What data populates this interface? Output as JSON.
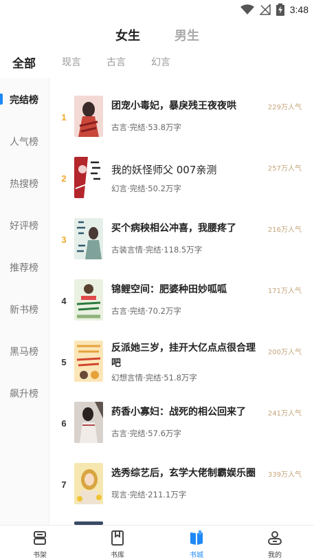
{
  "status_bar": {
    "time": "3:48"
  },
  "gender_tabs": {
    "female": "女生",
    "male": "男生"
  },
  "category_tabs": [
    "全部",
    "现言",
    "古言",
    "幻言"
  ],
  "sidebar": {
    "items": [
      "完结榜",
      "人气榜",
      "热搜榜",
      "好评榜",
      "推荐榜",
      "新书榜",
      "黑马榜",
      "飙升榜"
    ],
    "active_index": 0
  },
  "books": [
    {
      "rank": "1",
      "title": "团宠小毒妃，暴戾残王夜夜哄",
      "meta": "古言·完结·53.8万字",
      "popularity": "229万人气",
      "cover_colors": [
        "#f3d9d4",
        "#c9473a"
      ]
    },
    {
      "rank": "2",
      "title": "我的妖怪师父 007亲测",
      "meta": "幻言·完结·50.2万字",
      "popularity": "257万人气",
      "cover_colors": [
        "#ffffff",
        "#b3262b"
      ]
    },
    {
      "rank": "3",
      "title": "买个病秧相公冲喜，我腰疼了",
      "meta": "古装言情·完结·118.5万字",
      "popularity": "216万人气",
      "cover_colors": [
        "#e5efe9",
        "#7fa39a"
      ]
    },
    {
      "rank": "4",
      "title": "锦鲤空间：肥婆种田妙呱呱",
      "meta": "古言·完结·70.2万字",
      "popularity": "171万人气",
      "cover_colors": [
        "#eaf1e0",
        "#8fb37c"
      ]
    },
    {
      "rank": "5",
      "title": "反派她三岁，挂开大亿点点很合理吧",
      "meta": "幻想言情·完结·51.8万字",
      "popularity": "200万人气",
      "cover_colors": [
        "#fbe6b8",
        "#e6a23a"
      ]
    },
    {
      "rank": "6",
      "title": "药香小寡妇：战死的相公回来了",
      "meta": "古言·完结·57.6万字",
      "popularity": "241万人气",
      "cover_colors": [
        "#d9d2cc",
        "#5e534e"
      ]
    },
    {
      "rank": "7",
      "title": "选秀综艺后，玄学大佬制霸娱乐圈",
      "meta": "现言·完结·211.1万字",
      "popularity": "339万人气",
      "cover_colors": [
        "#f6e7b0",
        "#d8a540"
      ]
    }
  ],
  "bottom_nav": {
    "items": [
      "书架",
      "书库",
      "书城",
      "我的"
    ],
    "active_index": 2
  },
  "colors": {
    "accent": "#1e88f5",
    "rank_top": "#f0a92a",
    "popularity": "#c4a57a"
  }
}
